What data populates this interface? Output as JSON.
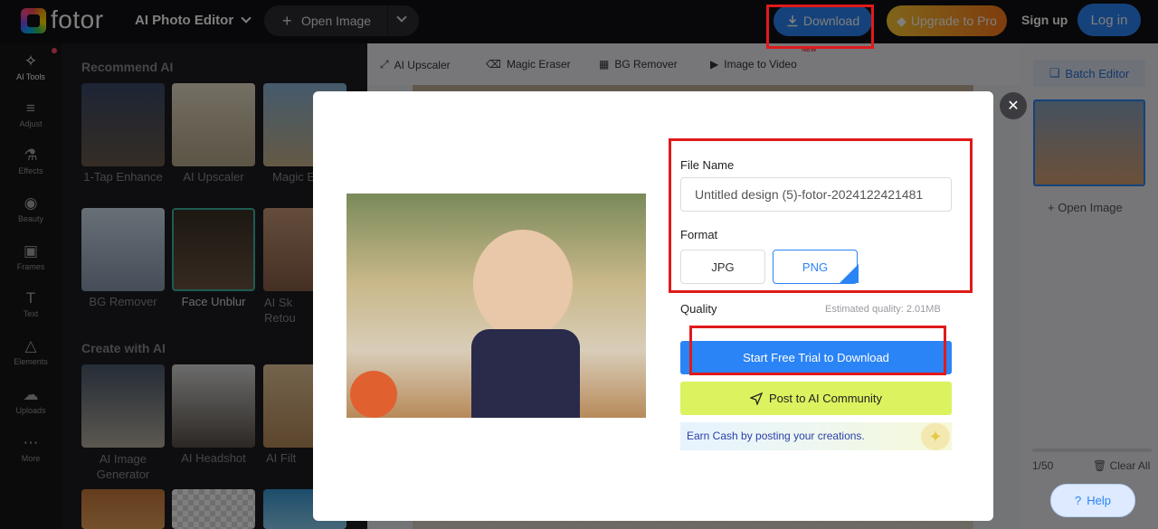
{
  "header": {
    "brand": "fotor",
    "app_title": "AI Photo Editor",
    "open_image_label": "Open Image",
    "download_label": "Download",
    "upgrade_label": "Upgrade to Pro",
    "signup_label": "Sign up",
    "login_label": "Log in"
  },
  "rail": {
    "items": [
      {
        "label": "AI Tools",
        "icon": "magic-wand-icon"
      },
      {
        "label": "Adjust",
        "icon": "sliders-icon"
      },
      {
        "label": "Effects",
        "icon": "flask-icon"
      },
      {
        "label": "Beauty",
        "icon": "eye-icon"
      },
      {
        "label": "Frames",
        "icon": "frame-icon"
      },
      {
        "label": "Text",
        "icon": "text-icon"
      },
      {
        "label": "Elements",
        "icon": "shapes-icon"
      },
      {
        "label": "Uploads",
        "icon": "cloud-upload-icon"
      },
      {
        "label": "More",
        "icon": "more-icon"
      }
    ]
  },
  "panel": {
    "recommend_title": "Recommend AI",
    "create_title": "Create with AI",
    "recommend_items": [
      "1-Tap Enhance",
      "AI Upscaler",
      "Magic E",
      "BG Remover",
      "Face Unblur",
      "AI Sk Retou"
    ],
    "create_items": [
      "AI Image Generator",
      "AI Headshot",
      "AI Filt"
    ]
  },
  "toolbar": {
    "items": [
      "AI Upscaler",
      "Magic Eraser",
      "BG Remover",
      "Image to Video"
    ],
    "new_tag": "NEW"
  },
  "right_panel": {
    "batch_editor": "Batch Editor",
    "open_image": "Open Image",
    "count": "1/50",
    "clear_all": "Clear All"
  },
  "modal": {
    "file_name_label": "File Name",
    "file_name_value": "Untitled design (5)-fotor-2024122421481",
    "format_label": "Format",
    "formats": [
      "JPG",
      "PNG"
    ],
    "selected_format": "PNG",
    "quality_label": "Quality",
    "estimated_quality": "Estimated quality: 2.01MB",
    "cta_label": "Start Free Trial to Download",
    "post_label": "Post to AI Community",
    "earn_text": "Earn Cash by posting your creations."
  },
  "help_label": "Help",
  "colors": {
    "accent": "#2b84f5",
    "highlight": "#e01a1a",
    "post_bg": "#ddf25f"
  }
}
